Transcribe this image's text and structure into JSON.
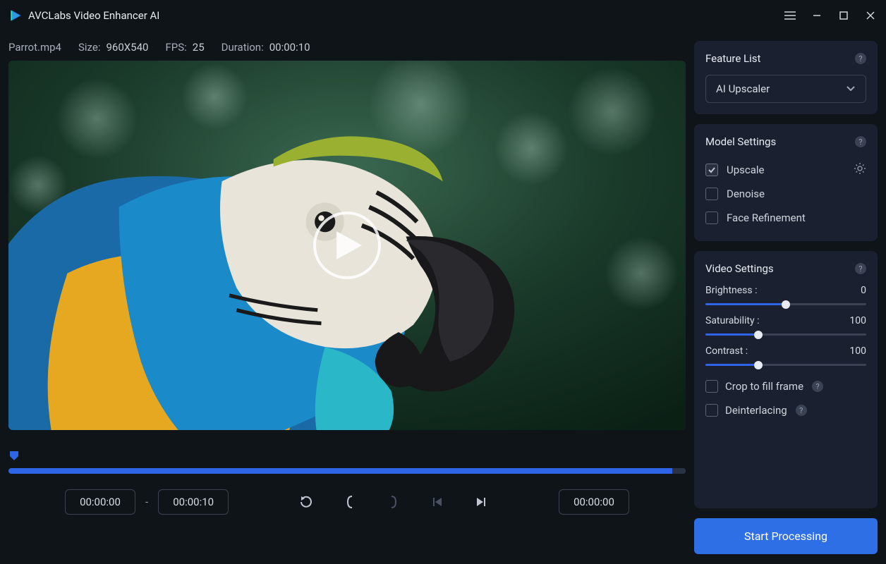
{
  "titlebar": {
    "app_name": "AVCLabs Video Enhancer AI"
  },
  "file": {
    "name": "Parrot.mp4",
    "size_label": "Size:",
    "size_value": "960X540",
    "fps_label": "FPS:",
    "fps_value": "25",
    "duration_label": "Duration:",
    "duration_value": "00:00:10"
  },
  "timeline": {
    "start_pill": "00:00:00",
    "dash": "-",
    "end_pill": "00:00:10",
    "current_pill": "00:00:00"
  },
  "panels": {
    "feature_list": {
      "title": "Feature List",
      "select_value": "AI Upscaler"
    },
    "model_settings": {
      "title": "Model Settings",
      "upscale": "Upscale",
      "denoise": "Denoise",
      "face_refinement": "Face Refinement"
    },
    "video_settings": {
      "title": "Video Settings",
      "brightness_label": "Brightness :",
      "brightness_value": "0",
      "saturability_label": "Saturability :",
      "saturability_value": "100",
      "contrast_label": "Contrast :",
      "contrast_value": "100",
      "crop_label": "Crop to fill frame",
      "deinterlacing_label": "Deinterlacing"
    }
  },
  "start_button": "Start Processing"
}
